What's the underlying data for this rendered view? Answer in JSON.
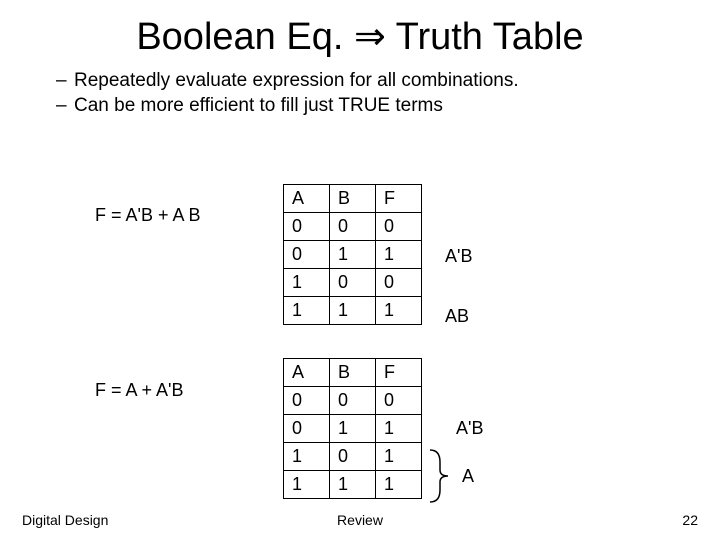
{
  "title_part1": "Boolean Eq. ",
  "title_arrow": "⇒",
  "title_part2": " Truth Table",
  "bullets": [
    "Repeatedly evaluate expression for all combinations.",
    "Can be more efficient to fill just TRUE terms"
  ],
  "eq1": "F = A'B + A B",
  "eq2": "F = A + A'B",
  "table_headers": [
    "A",
    "B",
    "F"
  ],
  "table1_rows": [
    [
      "0",
      "0",
      "0"
    ],
    [
      "0",
      "1",
      "1"
    ],
    [
      "1",
      "0",
      "0"
    ],
    [
      "1",
      "1",
      "1"
    ]
  ],
  "table2_rows": [
    [
      "0",
      "0",
      "0"
    ],
    [
      "0",
      "1",
      "1"
    ],
    [
      "1",
      "0",
      "1"
    ],
    [
      "1",
      "1",
      "1"
    ]
  ],
  "ann_t1_r2": "A'B",
  "ann_t1_r4": "AB",
  "ann_t2_r2": "A'B",
  "ann_t2_brace": "A",
  "footer_left": "Digital Design",
  "footer_center": "Review",
  "footer_right": "22"
}
